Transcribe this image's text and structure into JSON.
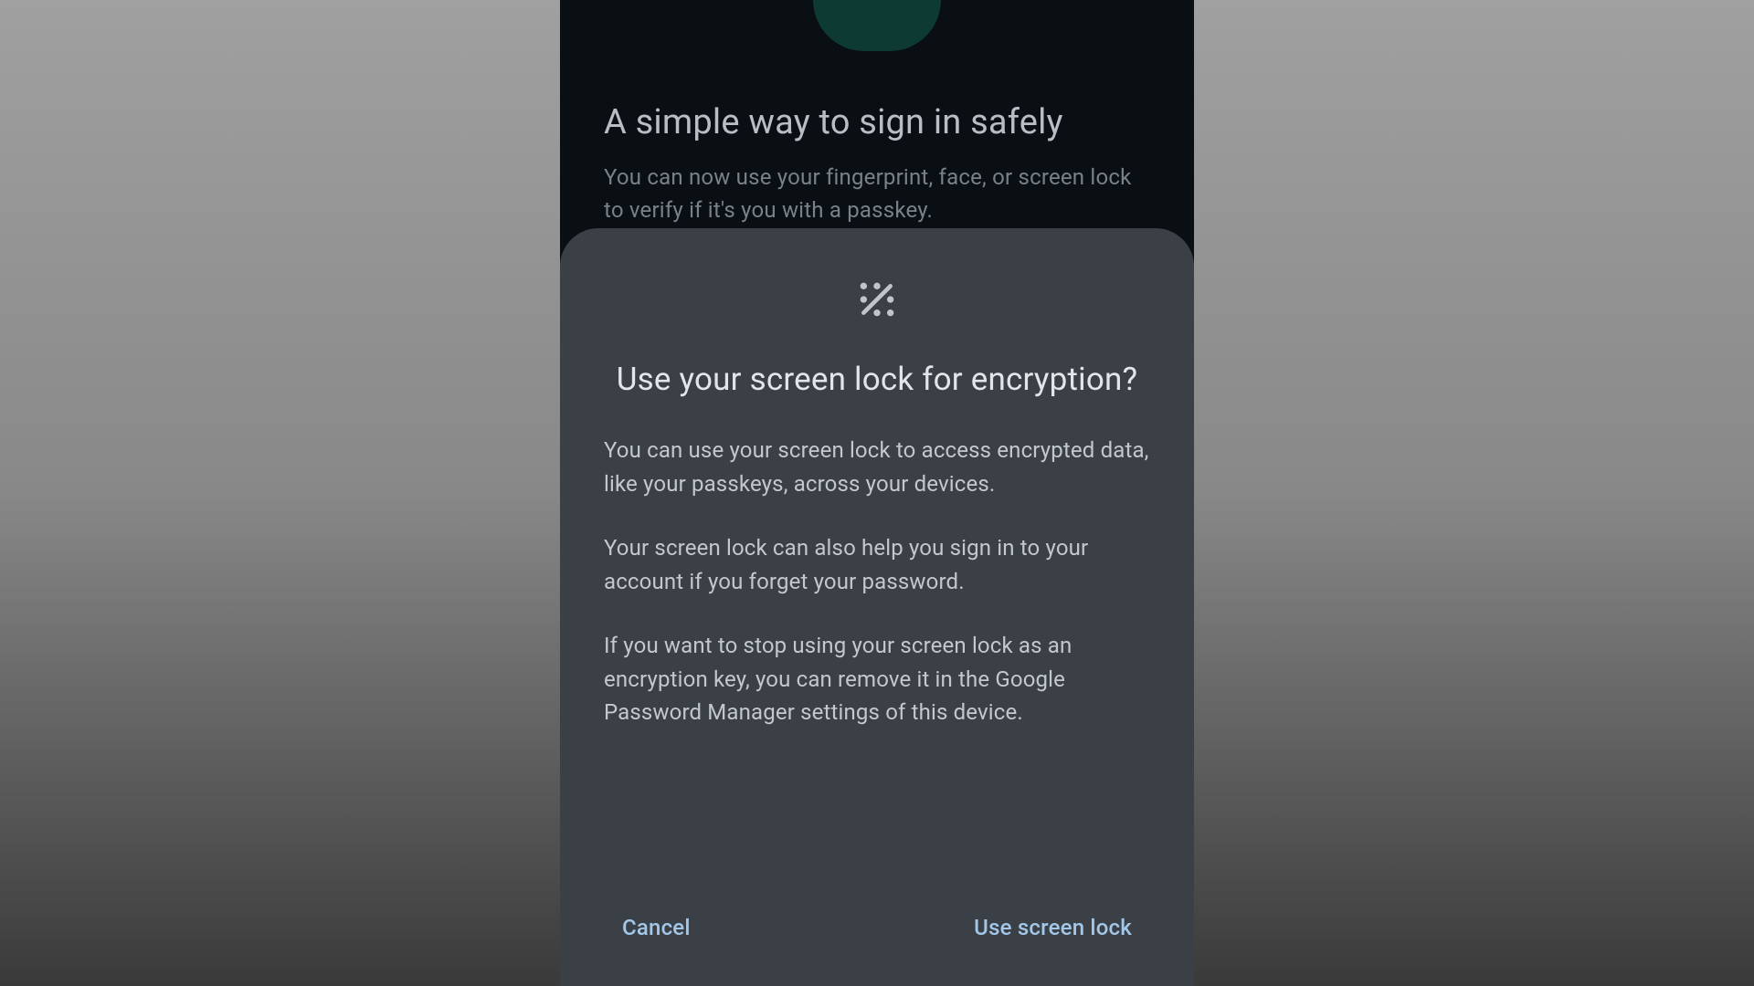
{
  "background": {
    "title": "A simple way to sign in safely",
    "subtitle": "You can now use your fingerprint, face, or screen lock to verify if it's you with a passkey."
  },
  "dialog": {
    "title": "Use your screen lock for encryption?",
    "para1": "You can use your screen lock to access encrypted data, like your passkeys, across your devices.",
    "para2": "Your screen lock can also help you sign in to your account if you forget your password.",
    "para3": "If you want to stop using your screen lock as an encryption key, you can remove it in the Google Password Manager settings of this device.",
    "cancel": "Cancel",
    "confirm": "Use screen lock"
  }
}
